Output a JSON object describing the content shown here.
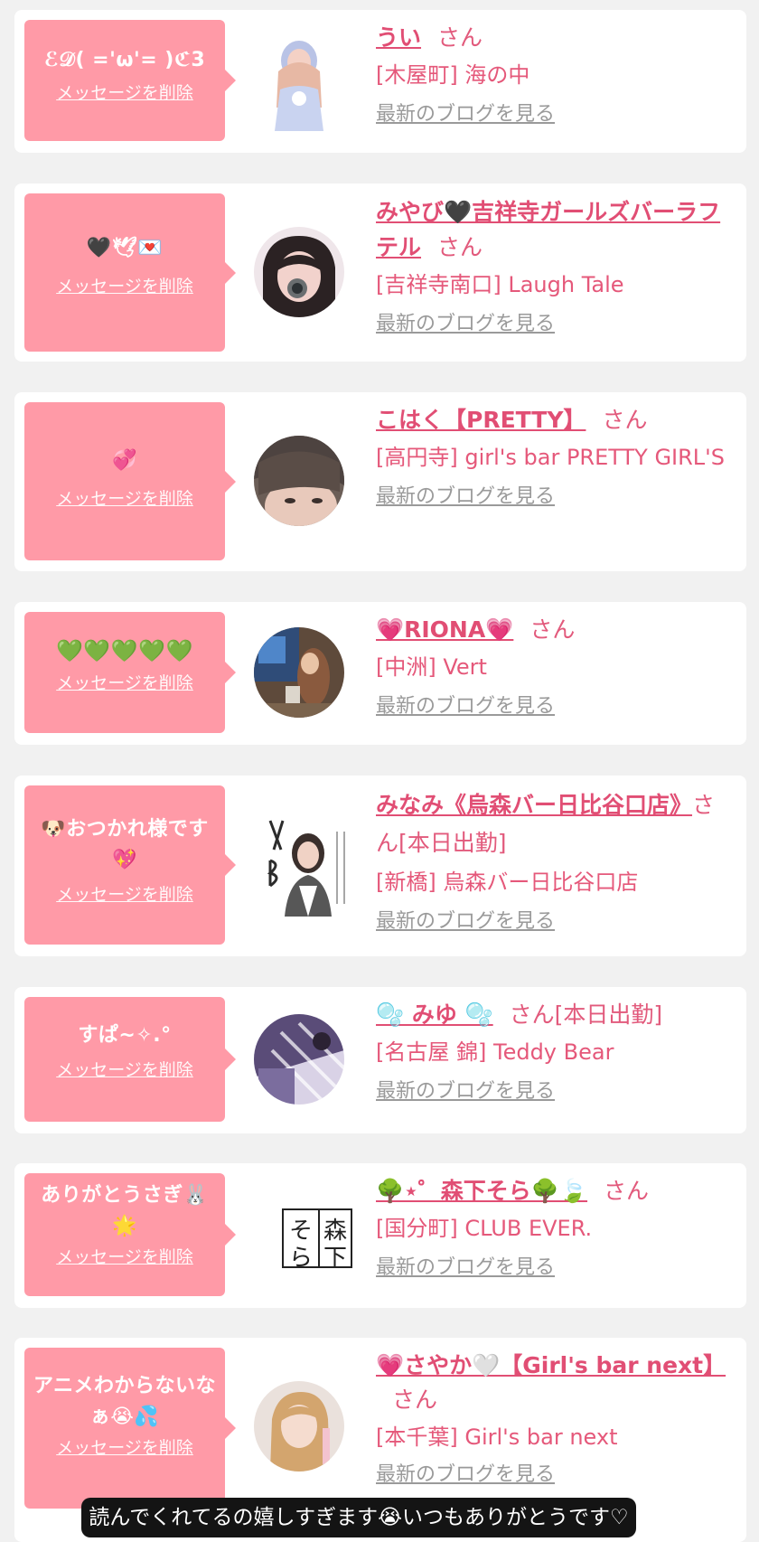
{
  "colors": {
    "page_background": "#f1f1f1",
    "card_background": "#ffffff",
    "bubble_pink": "#ff9aa7",
    "accent_text": "#e14e74",
    "link_gray": "#9a9a9a",
    "caption_background": "#141414"
  },
  "entries": [
    {
      "message": "ℰ𝒟( ='ω'= )ℭ3",
      "delete_label": "メッセージを削除",
      "name": "うい",
      "honorific": "さん",
      "shop": "[木屋町] 海の中",
      "blog_label": "最新のブログを見る"
    },
    {
      "message": "🖤🕊💌",
      "delete_label": "メッセージを削除",
      "name": "みやび🖤吉祥寺ガールズバーラフテル",
      "honorific": "さん",
      "shop": "[吉祥寺南口] Laugh Tale",
      "blog_label": "最新のブログを見る"
    },
    {
      "message": "💞",
      "delete_label": "メッセージを削除",
      "name": "こはく【PRETTY】",
      "honorific": "さん",
      "shop": "[高円寺] girl's bar PRETTY GIRL'S",
      "blog_label": "最新のブログを見る"
    },
    {
      "message": "💚💚💚💚💚",
      "delete_label": "メッセージを削除",
      "name": "💗RIONA💗",
      "honorific": "さん",
      "shop": "[中洲] Vert",
      "blog_label": "最新のブログを見る"
    },
    {
      "message": "🐶おつかれ様です💖",
      "delete_label": "メッセージを削除",
      "name": "みなみ《烏森バー日比谷口店》",
      "honorific": "さん[本日出勤]",
      "shop": "[新橋] 烏森バー日比谷口店",
      "blog_label": "最新のブログを見る"
    },
    {
      "message": "すぱ~✧.°",
      "delete_label": "メッセージを削除",
      "name": "🫧 みゆ 🫧",
      "honorific": "さん[本日出勤]",
      "shop": "[名古屋 錦] Teddy Bear",
      "blog_label": "最新のブログを見る"
    },
    {
      "message": "ありがとうさぎ🐰🌟",
      "delete_label": "メッセージを削除",
      "name": "🌳⋆゜森下そら🌳🍃",
      "honorific": "さん",
      "shop": "[国分町] CLUB EVER.",
      "blog_label": "最新のブログを見る",
      "avatar_text_top": "森",
      "avatar_text_bottom": "下",
      "avatar_text_left_top": "そ",
      "avatar_text_left_bottom": "ら"
    },
    {
      "message": "アニメわからないなぁ😭💦",
      "delete_label": "メッセージを削除",
      "name": "💗さやか🤍【Girl's bar next】",
      "honorific": "さん",
      "shop": "[本千葉] Girl's bar next",
      "blog_label": "最新のブログを見る"
    }
  ],
  "caption": "読んでくれてるの嬉しすぎます😭いつもありがとうです♡"
}
